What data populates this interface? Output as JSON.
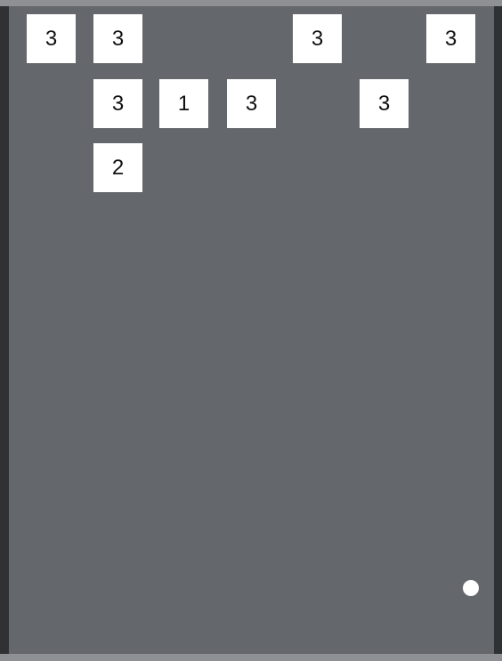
{
  "game": {
    "board_color": "#64676b",
    "wall_color": "#303132",
    "frame_color": "#8e9093",
    "block_color": "#ffffff",
    "ball_color": "#ffffff"
  },
  "blocks": [
    {
      "hits": "3"
    },
    {
      "hits": "3"
    },
    {
      "hits": "3"
    },
    {
      "hits": "3"
    },
    {
      "hits": "3"
    },
    {
      "hits": "1"
    },
    {
      "hits": "3"
    },
    {
      "hits": "3"
    },
    {
      "hits": "2"
    }
  ]
}
